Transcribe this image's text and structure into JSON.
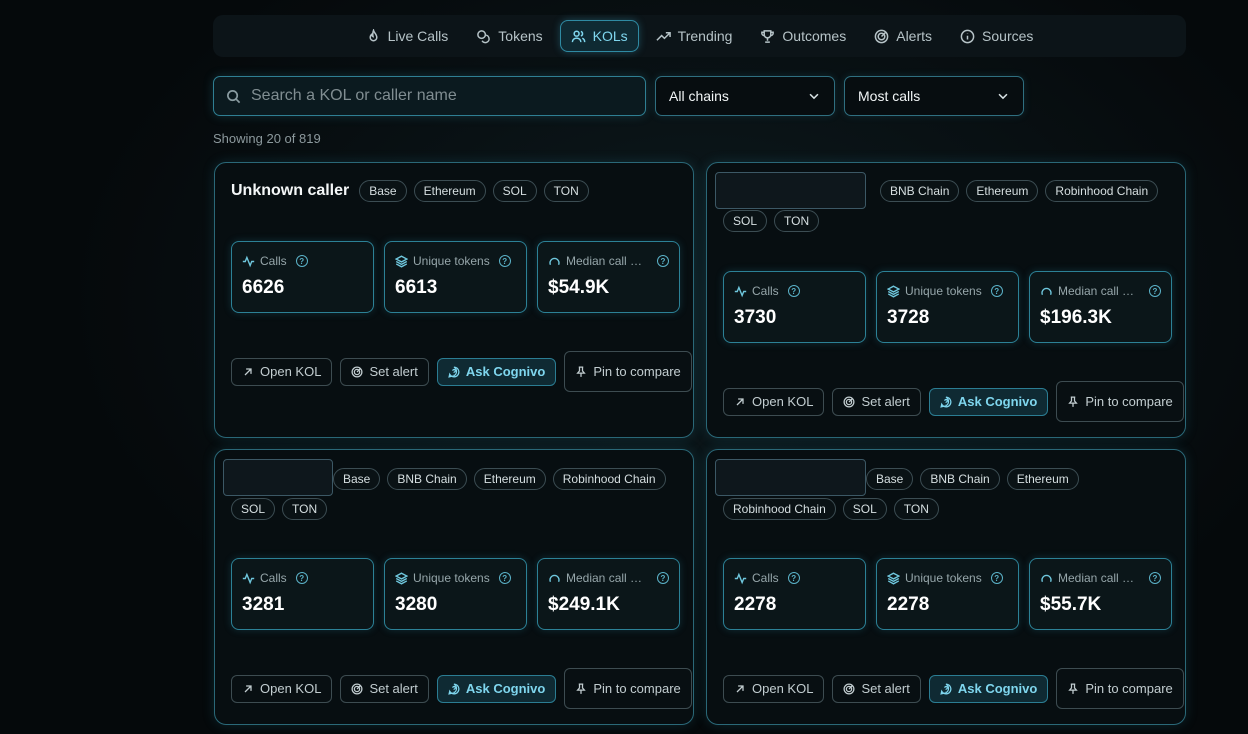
{
  "nav": {
    "tabs": [
      {
        "label": "Live Calls",
        "icon": "flame-icon"
      },
      {
        "label": "Tokens",
        "icon": "coins-icon"
      },
      {
        "label": "KOLs",
        "icon": "users-icon",
        "active": true
      },
      {
        "label": "Trending",
        "icon": "trending-up-icon"
      },
      {
        "label": "Outcomes",
        "icon": "trophy-icon"
      },
      {
        "label": "Alerts",
        "icon": "radar-icon"
      },
      {
        "label": "Sources",
        "icon": "info-icon"
      }
    ]
  },
  "filters": {
    "search_placeholder": "Search a KOL or caller name",
    "search_value": "",
    "chain_select": "All chains",
    "sort_select": "Most calls"
  },
  "results": {
    "showing_text": "Showing 20 of 819"
  },
  "stat_labels": {
    "calls": "Calls",
    "unique_tokens": "Unique tokens",
    "median": "Median call ma..."
  },
  "actions": {
    "open": "Open KOL",
    "alert": "Set alert",
    "ask": "Ask Cognivo",
    "pin": "Pin to compare"
  },
  "cards": [
    {
      "name": "Unknown caller",
      "chains": [
        "Base",
        "Ethereum",
        "SOL",
        "TON"
      ],
      "calls": "6626",
      "unique_tokens": "6613",
      "median": "$54.9K"
    },
    {
      "name": "",
      "chains": [
        "BNB Chain",
        "Ethereum",
        "Robinhood Chain",
        "SOL",
        "TON"
      ],
      "calls": "3730",
      "unique_tokens": "3728",
      "median": "$196.3K"
    },
    {
      "name": "",
      "chains": [
        "Base",
        "BNB Chain",
        "Ethereum",
        "Robinhood Chain",
        "SOL",
        "TON"
      ],
      "calls": "3281",
      "unique_tokens": "3280",
      "median": "$249.1K"
    },
    {
      "name": "",
      "chains": [
        "Base",
        "BNB Chain",
        "Ethereum",
        "Robinhood Chain",
        "SOL",
        "TON"
      ],
      "calls": "2278",
      "unique_tokens": "2278",
      "median": "$55.7K"
    }
  ]
}
